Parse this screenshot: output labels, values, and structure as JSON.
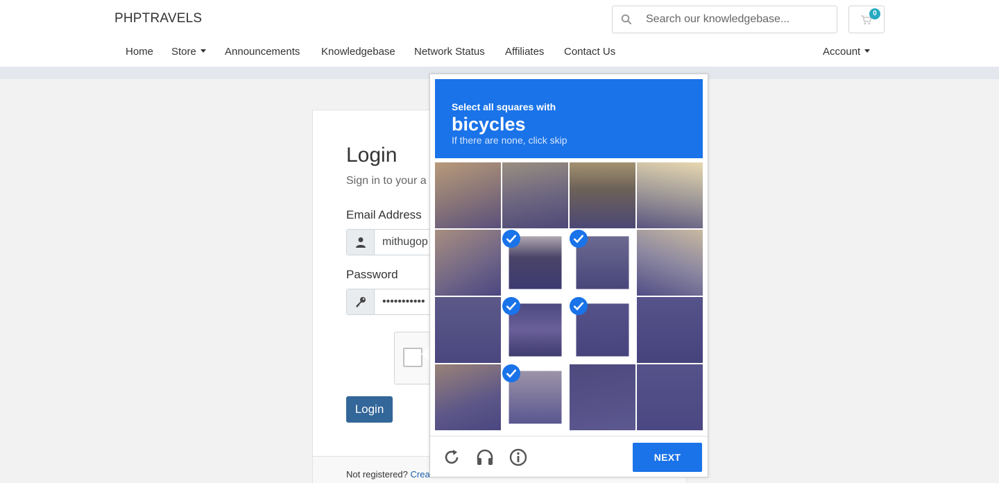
{
  "header": {
    "brand": "PHPTRAVELS",
    "search_placeholder": "Search our knowledgebase...",
    "cart_count": "0",
    "nav": {
      "home": "Home",
      "store": "Store",
      "announcements": "Announcements",
      "knowledgebase": "Knowledgebase",
      "network_status": "Network Status",
      "affiliates": "Affiliates",
      "contact_us": "Contact Us",
      "account": "Account"
    }
  },
  "login": {
    "title": "Login",
    "subtitle": "Sign in to your a",
    "email_label": "Email Address",
    "email_value": "mithugop",
    "password_label": "Password",
    "password_value": "•••••••••••",
    "button": "Login",
    "footer_text": "Not registered?",
    "footer_link": "Crea"
  },
  "captcha": {
    "instruction": "Select all squares with",
    "target": "bicycles",
    "hint": "If there are none, click skip",
    "next_button": "NEXT",
    "tiles": [
      {
        "selected": false
      },
      {
        "selected": false
      },
      {
        "selected": false
      },
      {
        "selected": false
      },
      {
        "selected": false
      },
      {
        "selected": true
      },
      {
        "selected": true
      },
      {
        "selected": false
      },
      {
        "selected": false
      },
      {
        "selected": true
      },
      {
        "selected": true
      },
      {
        "selected": false
      },
      {
        "selected": false
      },
      {
        "selected": true
      },
      {
        "selected": false
      },
      {
        "selected": false
      }
    ],
    "footer_icons": [
      "reload-icon",
      "audio-icon",
      "info-icon"
    ]
  }
}
